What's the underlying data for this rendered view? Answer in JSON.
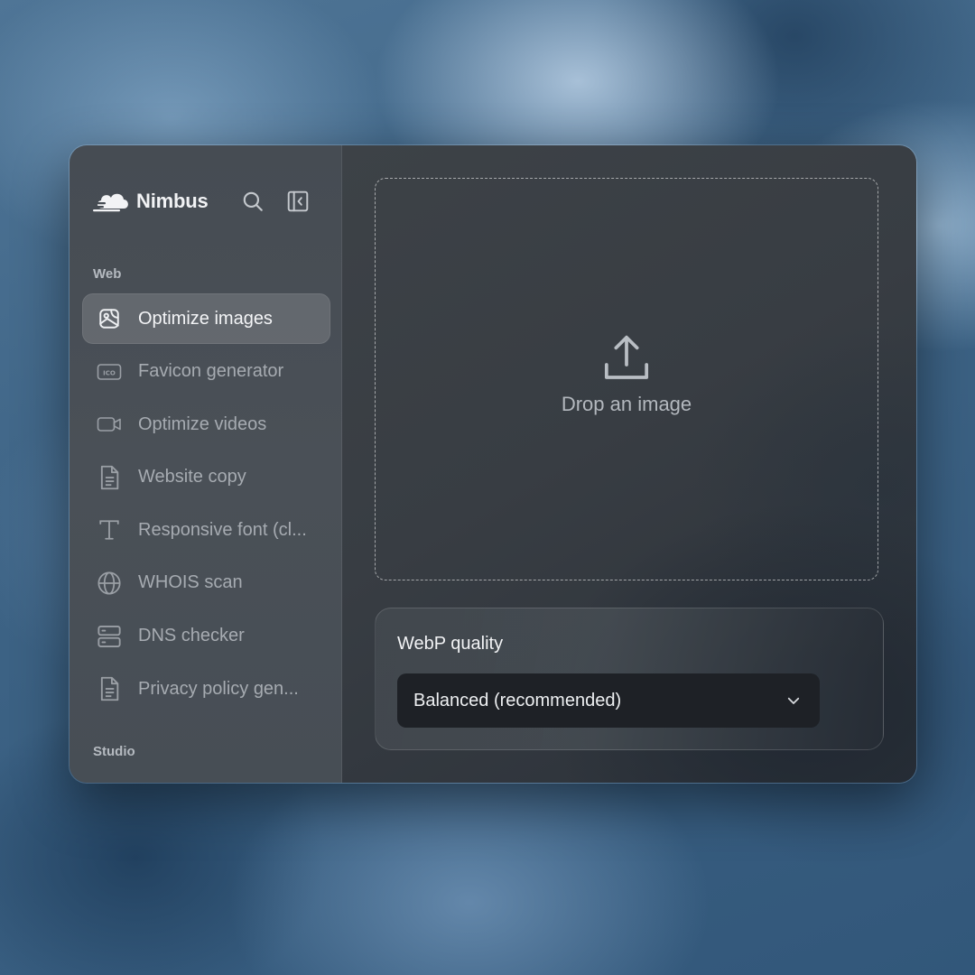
{
  "app": {
    "name": "Nimbus"
  },
  "sidebar": {
    "sections": [
      {
        "label": "Web"
      },
      {
        "label": "Studio"
      }
    ],
    "items": [
      {
        "label": "Optimize images",
        "icon": "image-icon",
        "active": true
      },
      {
        "label": "Favicon generator",
        "icon": "ico-file-icon",
        "active": false
      },
      {
        "label": "Optimize videos",
        "icon": "video-camera-icon",
        "active": false
      },
      {
        "label": "Website copy",
        "icon": "document-icon",
        "active": false
      },
      {
        "label": "Responsive font (cl...",
        "icon": "text-type-icon",
        "active": false
      },
      {
        "label": "WHOIS scan",
        "icon": "globe-icon",
        "active": false
      },
      {
        "label": "DNS checker",
        "icon": "server-icon",
        "active": false
      },
      {
        "label": "Privacy policy gen...",
        "icon": "document-icon",
        "active": false
      }
    ]
  },
  "main": {
    "dropzone": {
      "label": "Drop an image",
      "icon": "upload-icon"
    },
    "settings": {
      "title": "WebP quality",
      "select": {
        "value": "Balanced (recommended)"
      }
    }
  },
  "colors": {
    "accent_text": "#f2f3f5",
    "muted_text": "#a6abb1",
    "select_bg": "#1e2126"
  }
}
